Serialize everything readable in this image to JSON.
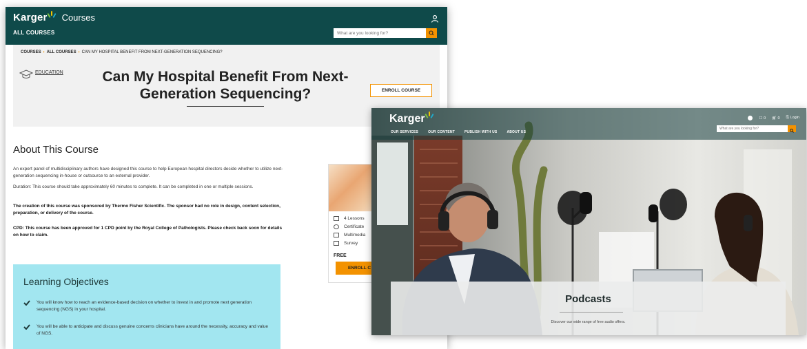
{
  "courses_page": {
    "brand": {
      "logo": "Karger",
      "product": "Courses"
    },
    "nav": {
      "all_courses": "ALL COURSES"
    },
    "search": {
      "placeholder": "What are you looking for?"
    },
    "breadcrumb": [
      {
        "label": "COURSES",
        "bold": true
      },
      {
        "label": "ALL COURSES",
        "bold": true
      },
      {
        "label": "CAN MY HOSPITAL BENEFIT FROM NEXT-GENERATION SEQUENCING?",
        "bold": false
      }
    ],
    "category": "EDUCATION",
    "title_line1": "Can My Hospital Benefit From Next-",
    "title_line2": "Generation Sequencing?",
    "enroll_label": "ENROLL COURSE",
    "about": {
      "title": "About This Course",
      "p1": "An expert panel of multidisciplinary authors have designed this course to help European hospital directors decide whether to utilize next-generation sequencing in-house or outsource to an external provider.",
      "p2": "Duration: This course should take approximately 60 minutes to complete. It can be completed in one or multiple sessions.",
      "p3": "The creation of this course was sponsored by Thermo Fisher Scientific. The sponsor had no role in design, content selection, preparation, or delivery of the course.",
      "p4": "CPD: This course has been approved for 1 CPD point by the Royal College of Pathologists. Please check back soon for details on how to claim."
    },
    "card": {
      "items": [
        "4 Lessons",
        "Certificate",
        "Multimedia",
        "Survey"
      ],
      "price": "FREE",
      "enroll_label": "ENROLL C"
    },
    "objectives": {
      "title": "Learning Objectives",
      "items": [
        "You will know how to reach an evidence-based decision on whether to invest in and promote next generation sequencing (NGS) in your hospital.",
        "You will be able to anticipate and discuss genuine concerns clinicians have around the necessity, accuracy and value of NGS."
      ]
    }
  },
  "podcasts_page": {
    "brand": {
      "logo": "Karger"
    },
    "menu": [
      "OUR SERVICES",
      "OUR CONTENT",
      "PUBLISH WITH US",
      "ABOUT US"
    ],
    "util": {
      "list": "0",
      "cart": "0",
      "login": "Login"
    },
    "search": {
      "placeholder": "What are you looking for?"
    },
    "banner": {
      "title": "Podcasts",
      "subtitle": "Discover our wide range of free audio offers."
    }
  },
  "colors": {
    "brand_dark": "#0f4a4a",
    "accent_orange": "#f39200",
    "objectives_bg": "#a2e6f0"
  }
}
